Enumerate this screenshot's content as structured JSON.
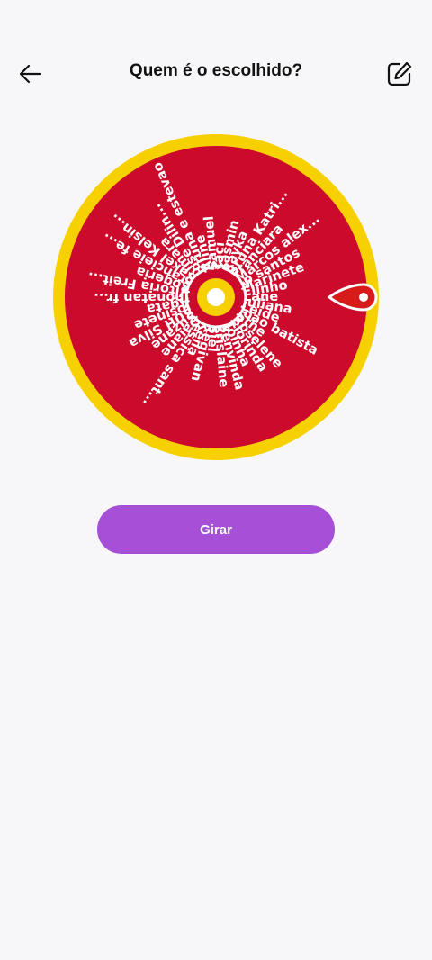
{
  "header": {
    "title": "Quem é o escolhido?",
    "back_icon": "arrow-left-icon",
    "edit_icon": "edit-square-icon"
  },
  "wheel": {
    "names": [
      "Lane",
      "Juliana",
      "Leide",
      "Joao batista",
      "Sthe",
      "Roselene",
      "Florinda",
      "Toinha",
      "Benvinda",
      "Erislaine",
      "Biel",
      "Regivan",
      "Keila",
      "Jessica sant...",
      "Daiane",
      "Suzane",
      "SUH Silva",
      "Josinete",
      "Agata",
      "Jhonatan fr...",
      "Vitoria Freit...",
      "Rogeria",
      "Francieie fe...",
      "Rakel Kelsin...",
      "Rimara",
      "Jose Dilin...",
      "Bruna e estevao",
      "Aline",
      "Samuel",
      "Taci",
      "Yasmin",
      "Rayka",
      "Bruna Katri...",
      "Franciara",
      "Marcos alex...",
      "Jp santos",
      "Marinete",
      "Elinho"
    ],
    "colors": {
      "rim": "#f7d000",
      "face": "#cc0a2c",
      "text": "#ffffff",
      "hub_ring": "#f7d000",
      "hub_center": "#ffffff",
      "pointer": "#d71a1a"
    },
    "pointer_icon": "pointer-marker-icon"
  },
  "actions": {
    "spin_label": "Girar",
    "spin_color": "#a550d6"
  }
}
